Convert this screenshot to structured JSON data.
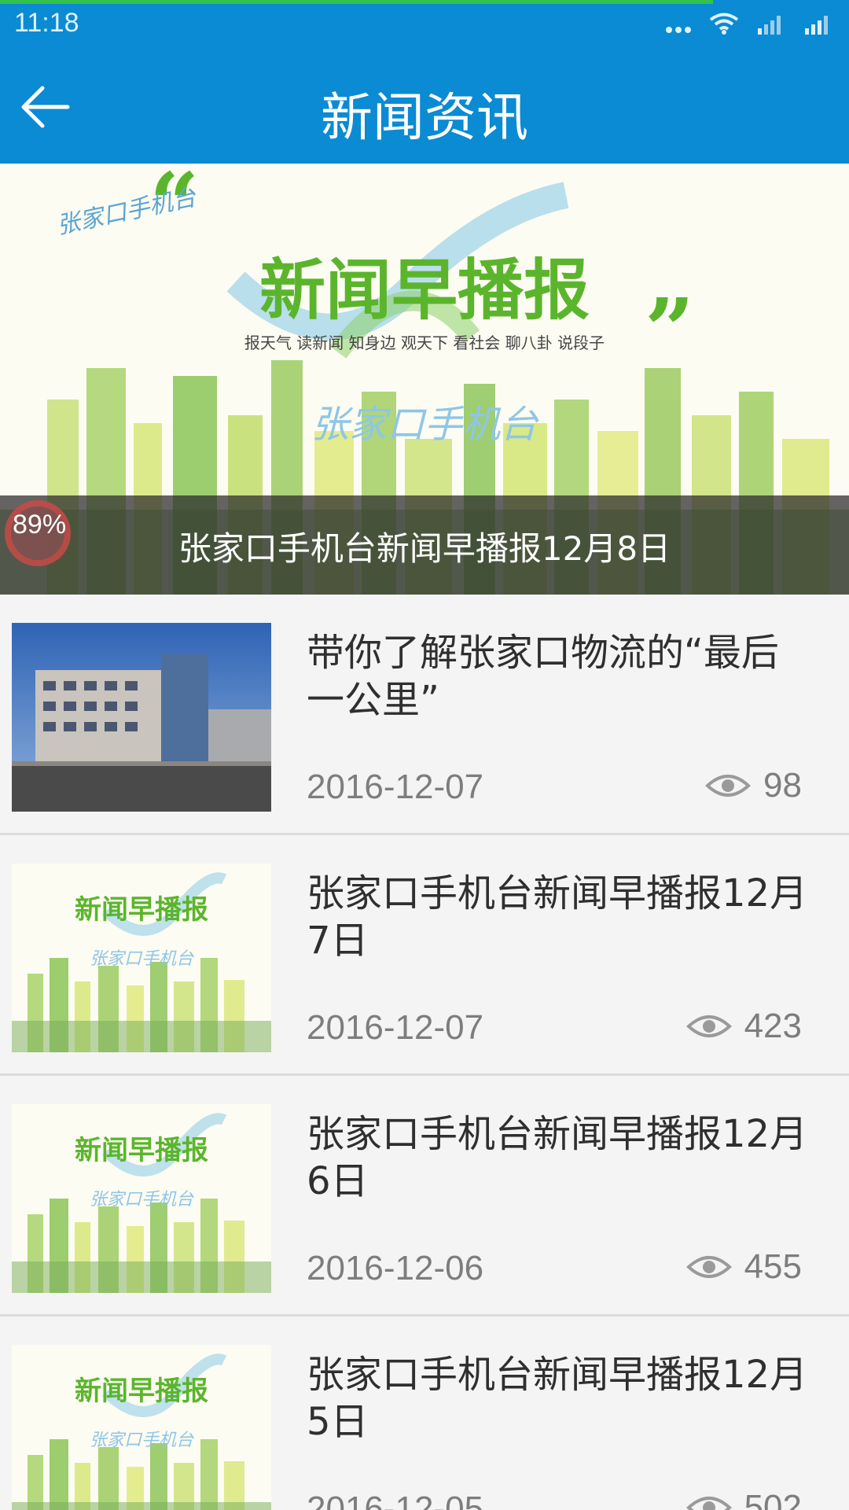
{
  "status_bar": {
    "time": "11:18",
    "icons": [
      "more-dots-icon",
      "wifi-icon",
      "signal-icon",
      "signal-icon"
    ],
    "load_progress": 0.84
  },
  "header": {
    "title": "新闻资讯",
    "back_icon": "arrow-left-icon",
    "bg_color": "#0a8bd3"
  },
  "banner": {
    "caption": "张家口手机台新闻早播报12月8日",
    "progress_label": "89%",
    "art": {
      "logo_text": "张家口手机台",
      "headline": "新闻早播报",
      "tagline": "报天气 读新闻 知身边 观天下 看社会 聊八卦 说段子",
      "watermark": "张家口手机台"
    }
  },
  "news": [
    {
      "title": "带你了解张家口物流的“最后一公里”",
      "date": "2016-12-07",
      "views": "98",
      "thumb": "building-photo"
    },
    {
      "title": "张家口手机台新闻早播报12月7日",
      "date": "2016-12-07",
      "views": "423",
      "thumb": "morning-news-art"
    },
    {
      "title": "张家口手机台新闻早播报12月6日",
      "date": "2016-12-06",
      "views": "455",
      "thumb": "morning-news-art"
    },
    {
      "title": "张家口手机台新闻早播报12月5日",
      "date": "2016-12-05",
      "views": "502",
      "thumb": "morning-news-art"
    }
  ]
}
